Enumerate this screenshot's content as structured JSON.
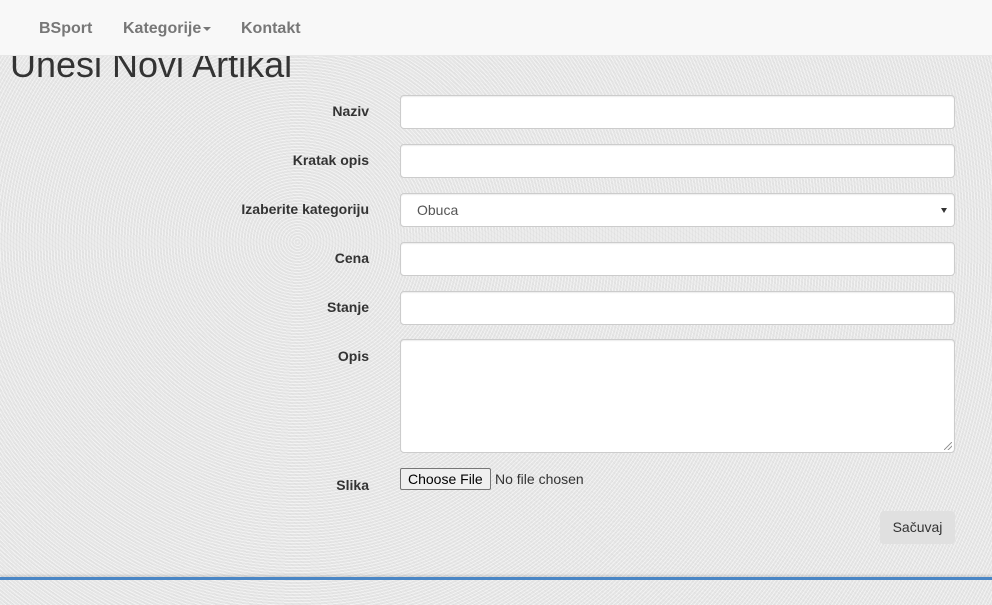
{
  "nav": {
    "brand": "BSport",
    "categories": "Kategorije",
    "contact": "Kontakt"
  },
  "page": {
    "title": "Unesi Novi Artikal"
  },
  "form": {
    "naziv": {
      "label": "Naziv",
      "value": ""
    },
    "kratak_opis": {
      "label": "Kratak opis",
      "value": ""
    },
    "kategorija": {
      "label": "Izaberite kategoriju",
      "selected": "Obuca"
    },
    "cena": {
      "label": "Cena",
      "value": ""
    },
    "stanje": {
      "label": "Stanje",
      "value": ""
    },
    "opis": {
      "label": "Opis",
      "value": ""
    },
    "slika": {
      "label": "Slika",
      "button": "Choose File",
      "status": "No file chosen"
    },
    "save": "Sačuvaj"
  },
  "colors": {
    "footer_accent": "#4a86c5",
    "navbar_bg": "#f8f8f8"
  }
}
